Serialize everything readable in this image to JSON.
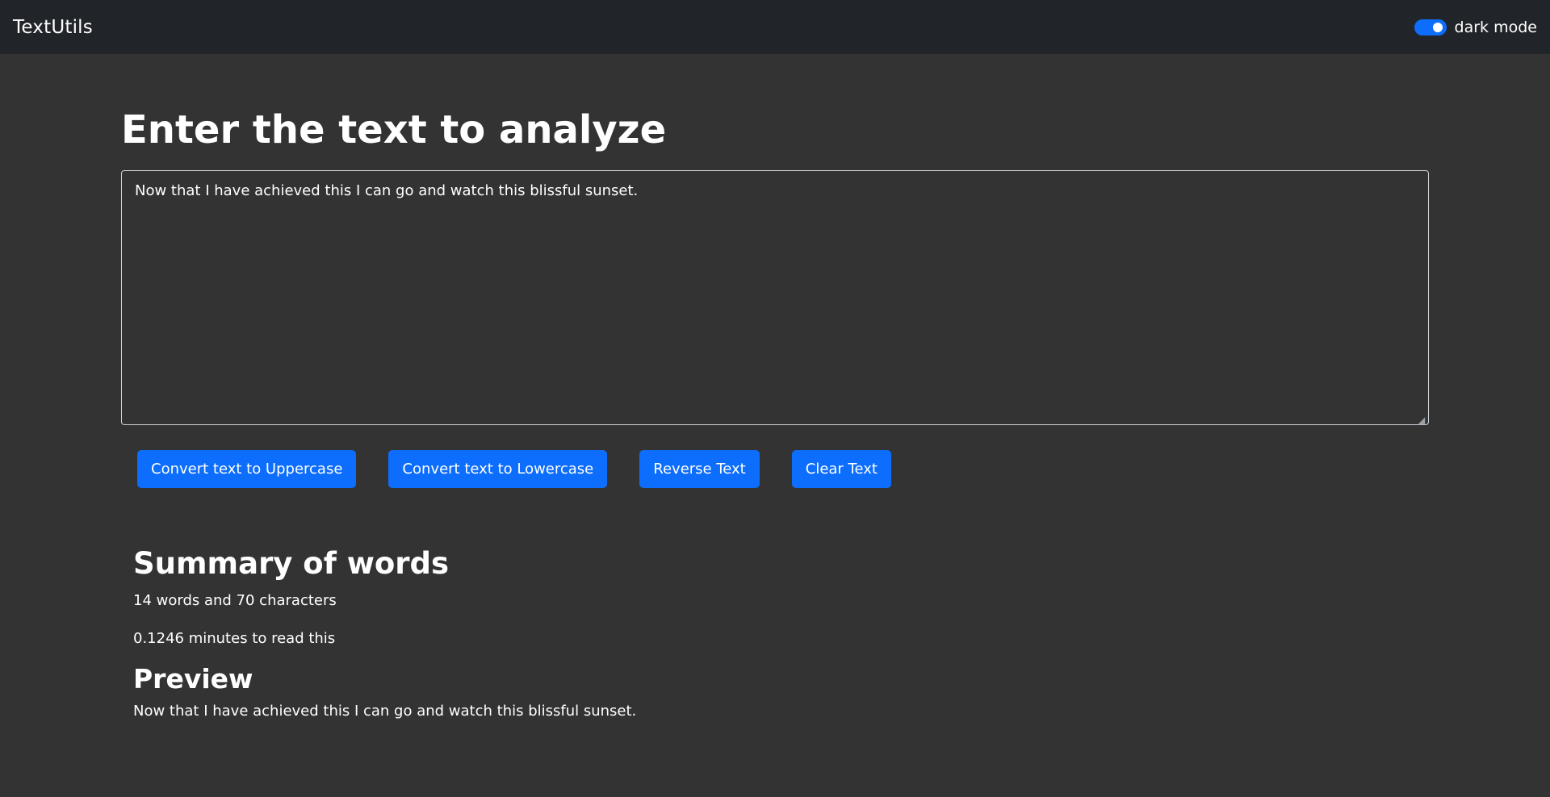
{
  "navbar": {
    "brand": "TextUtils",
    "mode_label": "dark mode",
    "mode_enabled": true
  },
  "main": {
    "title": "Enter the text to analyze",
    "textarea_value": "Now that I have achieved this I can go and watch this blissful sunset.",
    "buttons": {
      "uppercase": "Convert text to Uppercase",
      "lowercase": "Convert text to Lowercase",
      "reverse": "Reverse Text",
      "clear": "Clear Text"
    }
  },
  "summary": {
    "heading": "Summary of words",
    "counts": "14 words and 70 characters",
    "read_time": "0.1246 minutes to read this",
    "preview_heading": "Preview",
    "preview_text": "Now that I have achieved this I can go and watch this blissful sunset."
  },
  "colors": {
    "navbar_bg": "#212529",
    "page_bg": "#333333",
    "accent": "#0d6efd"
  }
}
